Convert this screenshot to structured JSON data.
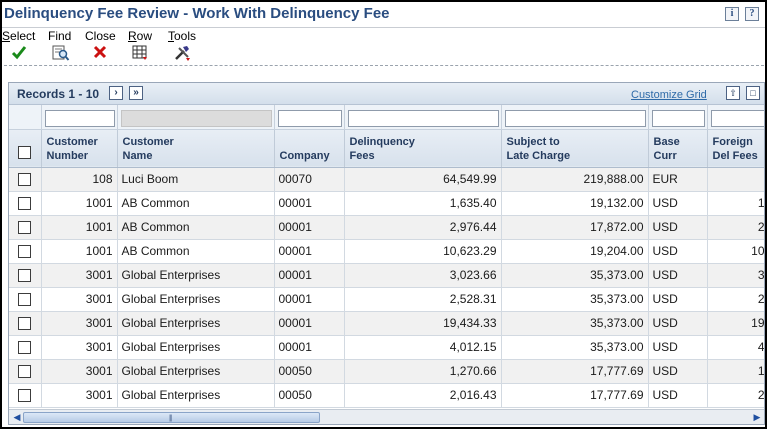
{
  "window": {
    "title": "Delinquency Fee Review - Work With Delinquency Fee",
    "icons": [
      "info-icon",
      "help-icon"
    ]
  },
  "toolbar": {
    "select": {
      "label_ul": "S",
      "label_rest": "elect",
      "icon": "checkmark-icon",
      "color": "#1a8a1a"
    },
    "find": {
      "label_ul": "",
      "label_rest": "Find",
      "icon": "find-icon"
    },
    "close": {
      "label_ul": "",
      "label_rest": "Close",
      "icon": "close-icon",
      "color": "#cc1111"
    },
    "row": {
      "label_ul": "R",
      "label_rest": "ow",
      "icon": "row-grid-icon"
    },
    "tools": {
      "label_ul": "T",
      "label_rest": "ools",
      "icon": "tools-icon"
    }
  },
  "grid": {
    "records_label": "Records 1 - 10",
    "customize_label": "Customize Grid",
    "columns": [
      {
        "key": "customer_number",
        "label_line1": "Customer",
        "label_line2": "Number"
      },
      {
        "key": "customer_name",
        "label_line1": "Customer",
        "label_line2": "Name"
      },
      {
        "key": "company",
        "label_line1": "",
        "label_line2": "Company"
      },
      {
        "key": "delinquency_fees",
        "label_line1": "Delinquency",
        "label_line2": "Fees"
      },
      {
        "key": "subject_to_late_charge",
        "label_line1": "Subject to",
        "label_line2": "Late Charge"
      },
      {
        "key": "base_curr",
        "label_line1": "Base",
        "label_line2": "Curr"
      },
      {
        "key": "foreign_del_fees",
        "label_line1": "Foreign",
        "label_line2": "Del Fees"
      }
    ],
    "rows": [
      {
        "customer_number": "108",
        "customer_name": "Luci Boom",
        "company": "00070",
        "delinquency_fees": "64,549.99",
        "subject_to_late_charge": "219,888.00",
        "base_curr": "EUR",
        "foreign_del_fees": ""
      },
      {
        "customer_number": "1001",
        "customer_name": "AB Common",
        "company": "00001",
        "delinquency_fees": "1,635.40",
        "subject_to_late_charge": "19,132.00",
        "base_curr": "USD",
        "foreign_del_fees": "1"
      },
      {
        "customer_number": "1001",
        "customer_name": "AB Common",
        "company": "00001",
        "delinquency_fees": "2,976.44",
        "subject_to_late_charge": "17,872.00",
        "base_curr": "USD",
        "foreign_del_fees": "2"
      },
      {
        "customer_number": "1001",
        "customer_name": "AB Common",
        "company": "00001",
        "delinquency_fees": "10,623.29",
        "subject_to_late_charge": "19,204.00",
        "base_curr": "USD",
        "foreign_del_fees": "10"
      },
      {
        "customer_number": "3001",
        "customer_name": "Global Enterprises",
        "company": "00001",
        "delinquency_fees": "3,023.66",
        "subject_to_late_charge": "35,373.00",
        "base_curr": "USD",
        "foreign_del_fees": "3"
      },
      {
        "customer_number": "3001",
        "customer_name": "Global Enterprises",
        "company": "00001",
        "delinquency_fees": "2,528.31",
        "subject_to_late_charge": "35,373.00",
        "base_curr": "USD",
        "foreign_del_fees": "2"
      },
      {
        "customer_number": "3001",
        "customer_name": "Global Enterprises",
        "company": "00001",
        "delinquency_fees": "19,434.33",
        "subject_to_late_charge": "35,373.00",
        "base_curr": "USD",
        "foreign_del_fees": "19"
      },
      {
        "customer_number": "3001",
        "customer_name": "Global Enterprises",
        "company": "00001",
        "delinquency_fees": "4,012.15",
        "subject_to_late_charge": "35,373.00",
        "base_curr": "USD",
        "foreign_del_fees": "4"
      },
      {
        "customer_number": "3001",
        "customer_name": "Global Enterprises",
        "company": "00050",
        "delinquency_fees": "1,270.66",
        "subject_to_late_charge": "17,777.69",
        "base_curr": "USD",
        "foreign_del_fees": "1"
      },
      {
        "customer_number": "3001",
        "customer_name": "Global Enterprises",
        "company": "00050",
        "delinquency_fees": "2,016.43",
        "subject_to_late_charge": "17,777.69",
        "base_curr": "USD",
        "foreign_del_fees": "2"
      }
    ]
  }
}
